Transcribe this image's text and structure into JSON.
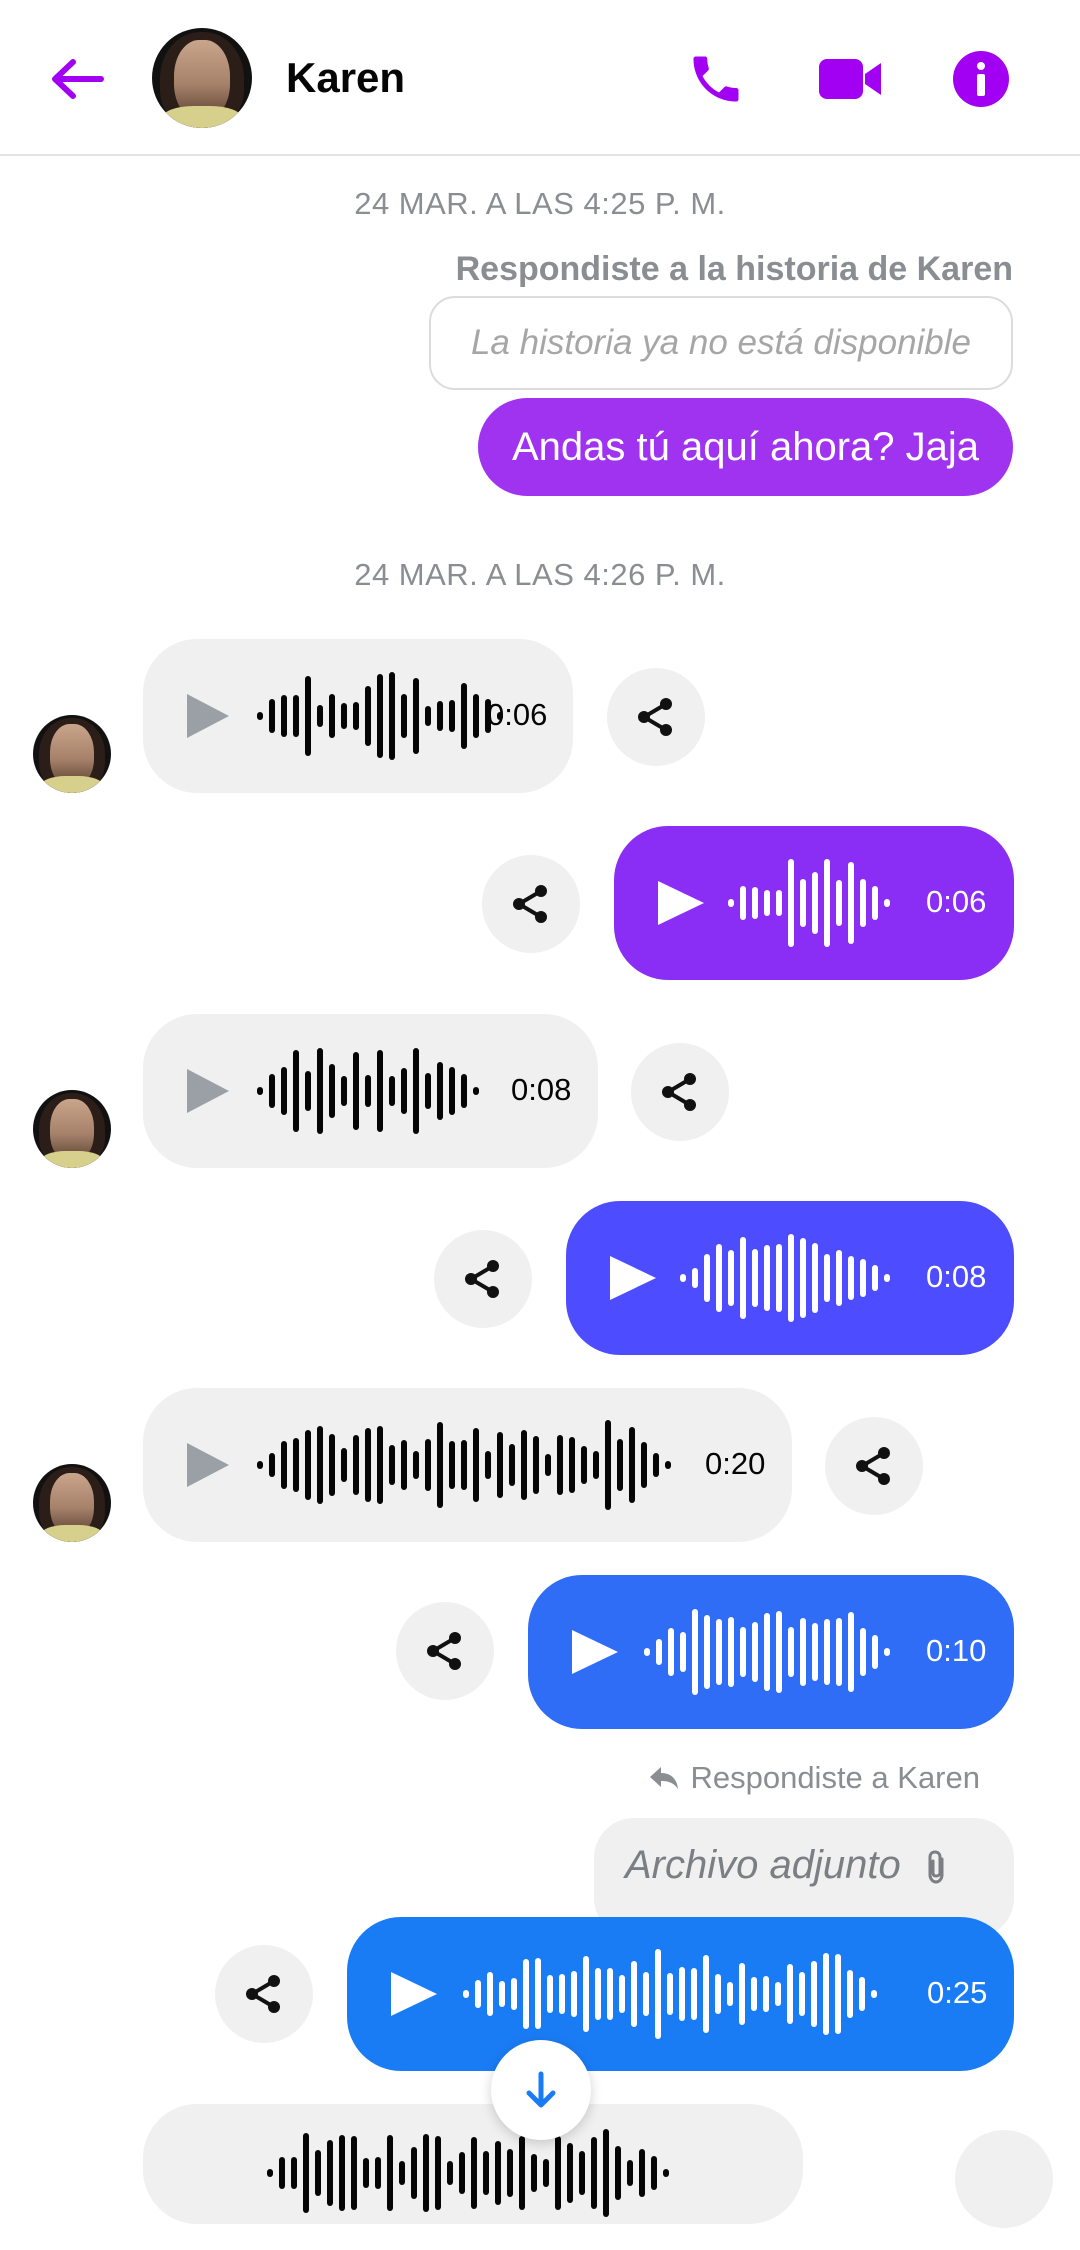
{
  "header": {
    "contact_name": "Karen",
    "accent": "#a100f2"
  },
  "conversation": {
    "timestamp_1": "24 MAR. A LAS 4:25 P. M.",
    "story_reply_title": "Respondiste a la historia de Karen",
    "story_unavailable": "La historia ya no está disponible",
    "sent_text": "Andas tú aquí ahora? Jaja",
    "timestamp_2": "24 MAR. A LAS 4:26 P. M.",
    "voice_messages": [
      {
        "direction": "incoming",
        "duration": "0:06"
      },
      {
        "direction": "outgoing",
        "duration": "0:06",
        "color": "#8a2ef5"
      },
      {
        "direction": "incoming",
        "duration": "0:08"
      },
      {
        "direction": "outgoing",
        "duration": "0:08",
        "color": "#4d4dff"
      },
      {
        "direction": "incoming",
        "duration": "0:20"
      },
      {
        "direction": "outgoing",
        "duration": "0:10",
        "color": "#2f6df6"
      },
      {
        "direction": "outgoing",
        "duration": "0:25",
        "color": "#1a7cf5"
      }
    ],
    "reply_to_label": "Respondiste a Karen",
    "attachment_label": "Archivo adjunto"
  },
  "icons": [
    "back-arrow-icon",
    "phone-icon",
    "video-camera-icon",
    "info-icon",
    "share-icon",
    "play-icon",
    "reply-icon",
    "paperclip-icon",
    "arrow-down-icon"
  ]
}
